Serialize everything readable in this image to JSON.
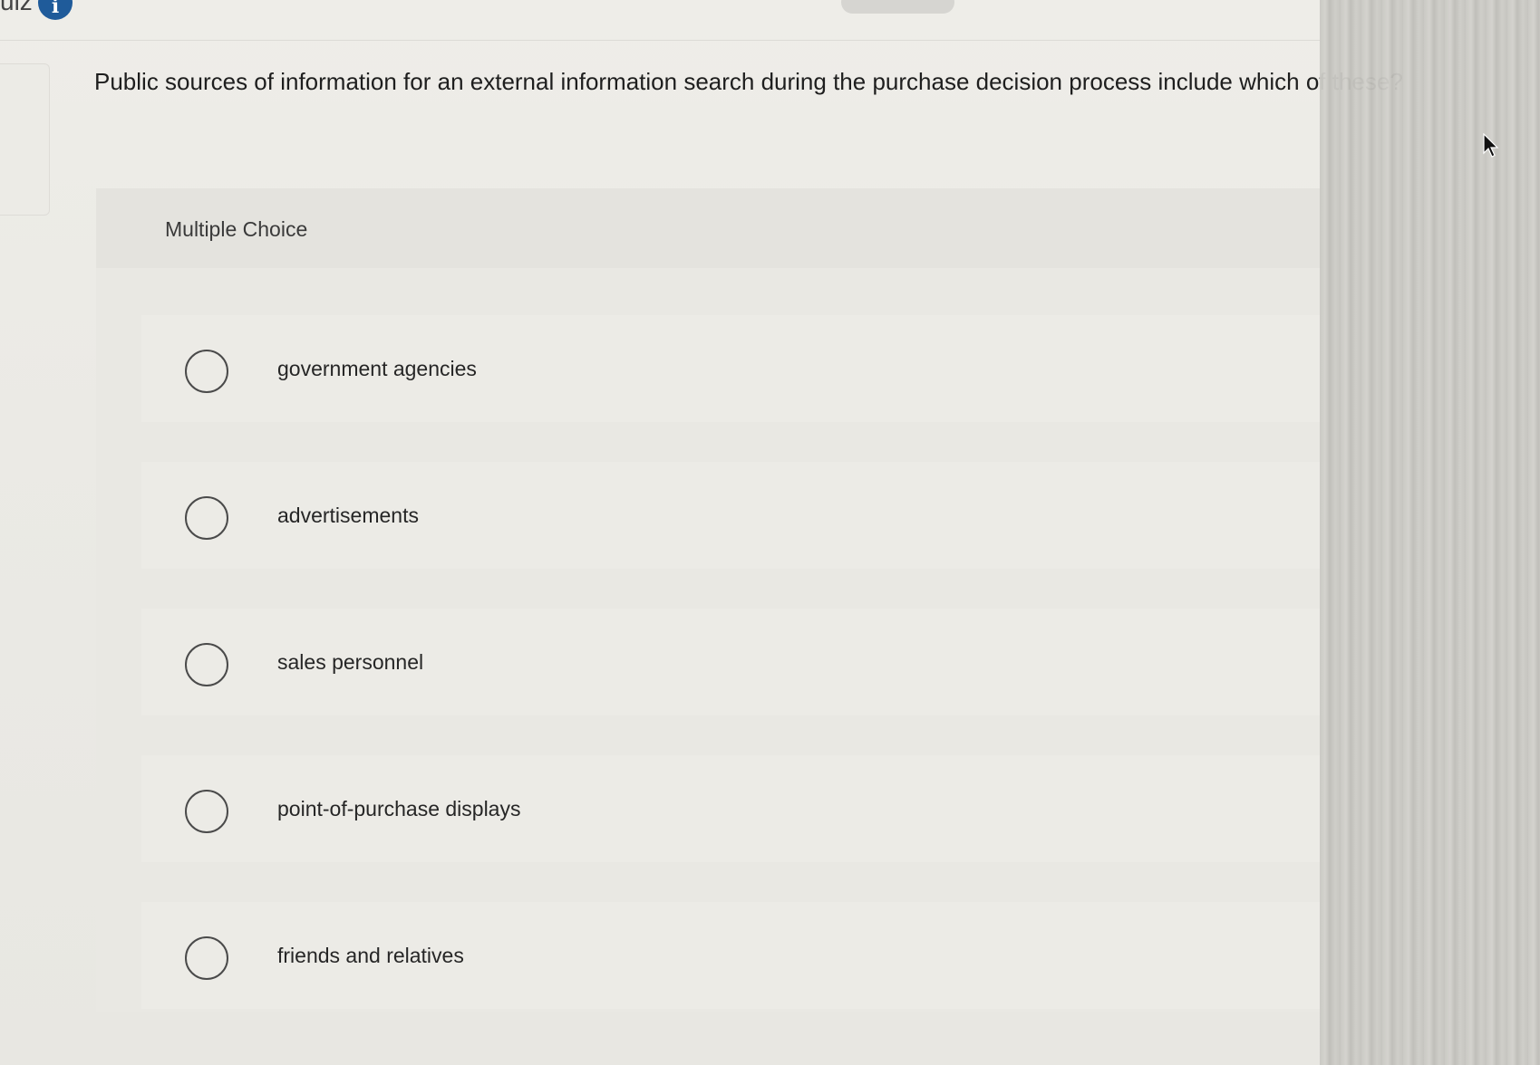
{
  "header": {
    "quiz_label": "uiz",
    "info_badge": "i"
  },
  "question": {
    "text": "Public sources of information for an external information search during the purchase decision process include which of these?"
  },
  "choices": {
    "heading": "Multiple Choice",
    "options": [
      {
        "label": "government agencies",
        "selected": false
      },
      {
        "label": "advertisements",
        "selected": false
      },
      {
        "label": "sales personnel",
        "selected": false
      },
      {
        "label": "point-of-purchase displays",
        "selected": false
      },
      {
        "label": "friends and relatives",
        "selected": false
      }
    ]
  },
  "icons": {
    "cursor": "mouse-pointer-icon",
    "info": "info-icon",
    "radio": "radio-unchecked-icon"
  },
  "colors": {
    "info_badge": "#1f5b9a",
    "page_background": "#eeede8"
  }
}
